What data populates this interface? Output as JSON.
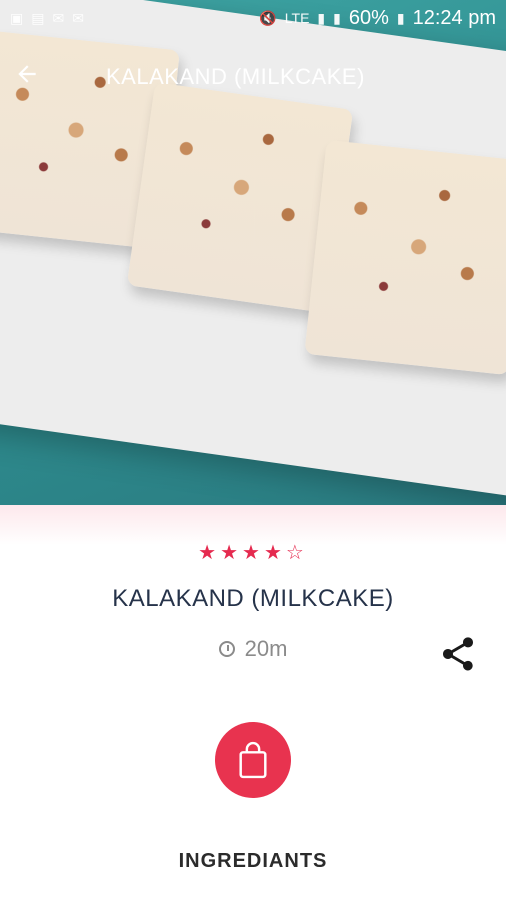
{
  "status_bar": {
    "battery": "60%",
    "time": "12:24 pm",
    "network": "LTE"
  },
  "app_bar": {
    "title": "KALAKAND (MILKCAKE)"
  },
  "recipe": {
    "rating": 4,
    "rating_max": 5,
    "name": "KALAKAND (MILKCAKE)",
    "time": "20m"
  },
  "ingredients_label": "INGREDIANTS",
  "colors": {
    "accent": "#e8334f",
    "title_text": "#26334a",
    "muted_text": "#8b8b8b"
  }
}
